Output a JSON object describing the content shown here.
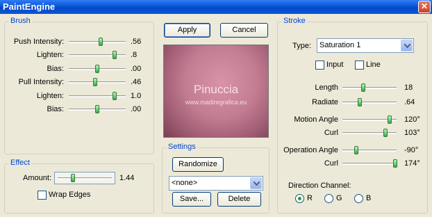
{
  "window": {
    "title": "PaintEngine",
    "close_glyph": "✕"
  },
  "brush": {
    "legend": "Brush",
    "rows": [
      {
        "label": "Push Intensity:",
        "value": ".56",
        "level": 0.56
      },
      {
        "label": "Lighten:",
        "value": ".8",
        "level": 0.8
      },
      {
        "label": "Bias:",
        "value": ".00",
        "level": 0.5
      },
      {
        "label": "Pull Intensity:",
        "value": ".46",
        "level": 0.46
      },
      {
        "label": "Lighten:",
        "value": "1.0",
        "level": 0.8
      },
      {
        "label": "Bias:",
        "value": ".00",
        "level": 0.5
      }
    ]
  },
  "effect": {
    "legend": "Effect",
    "amount_label": "Amount:",
    "amount_value": "1.44",
    "wrap_edges_label": "Wrap Edges",
    "wrap_edges_checked": false
  },
  "buttons": {
    "apply": "Apply",
    "cancel": "Cancel",
    "randomize": "Randomize",
    "save": "Save...",
    "delete": "Delete"
  },
  "preview": {
    "watermark_name": "Pinuccia",
    "watermark_url": "www.madiregrafica.eu"
  },
  "settings": {
    "legend": "Settings",
    "preset_value": "<none>"
  },
  "stroke": {
    "legend": "Stroke",
    "type_label": "Type:",
    "type_value": "Saturation 1",
    "input_label": "Input",
    "line_label": "Line",
    "rows": [
      {
        "label": "Length",
        "value": "18",
        "level": 0.38
      },
      {
        "label": "Radiate",
        "value": ".64",
        "level": 0.32
      },
      {
        "label": "Motion Angle",
        "value": "120°",
        "level": 0.87
      },
      {
        "label": "Curl",
        "value": "103°",
        "level": 0.8
      },
      {
        "label": "Operation Angle",
        "value": "-90°",
        "level": 0.25
      },
      {
        "label": "Curl",
        "value": "174°",
        "level": 0.98
      }
    ],
    "direction_label": "Direction Channel:",
    "channels": [
      {
        "label": "R",
        "checked": true
      },
      {
        "label": "G",
        "checked": false
      },
      {
        "label": "B",
        "checked": false
      }
    ]
  },
  "colors": {
    "accent": "#0046d5",
    "slider_thumb": "#3ca747",
    "title_bar": "#0a56d8"
  },
  "icons": {
    "close": "close-icon",
    "dropdown": "chevron-down-icon"
  }
}
